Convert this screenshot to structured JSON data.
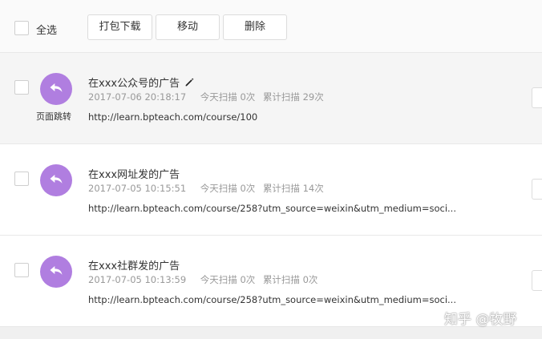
{
  "toolbar": {
    "select_all_label": "全选",
    "pack_download_label": "打包下载",
    "move_label": "移动",
    "delete_label": "删除"
  },
  "items": [
    {
      "title": "在xxx公众号的广告",
      "datetime": "2017-07-06 20:18:17",
      "today_scans": "今天扫描 0次",
      "total_scans": "累计扫描 29次",
      "url": "http://learn.bpteach.com/course/100",
      "avatar_label": "页面跳转",
      "icon": "reply-arrow-icon",
      "editable": true
    },
    {
      "title": "在xxx网址发的广告",
      "datetime": "2017-07-05 10:15:51",
      "today_scans": "今天扫描 0次",
      "total_scans": "累计扫描 14次",
      "url": "http://learn.bpteach.com/course/258?utm_source=weixin&utm_medium=soci...",
      "icon": "reply-arrow-icon"
    },
    {
      "title": "在xxx社群发的广告",
      "datetime": "2017-07-05 10:13:59",
      "today_scans": "今天扫描 0次",
      "total_scans": "累计扫描 0次",
      "url": "http://learn.bpteach.com/course/258?utm_source=weixin&utm_medium=soci...",
      "icon": "reply-arrow-icon"
    }
  ],
  "watermark": "知乎 @牧野",
  "colors": {
    "avatar": "#b07ee0",
    "meta_text": "#999999",
    "selected_row_bg": "#f5f5f5"
  }
}
